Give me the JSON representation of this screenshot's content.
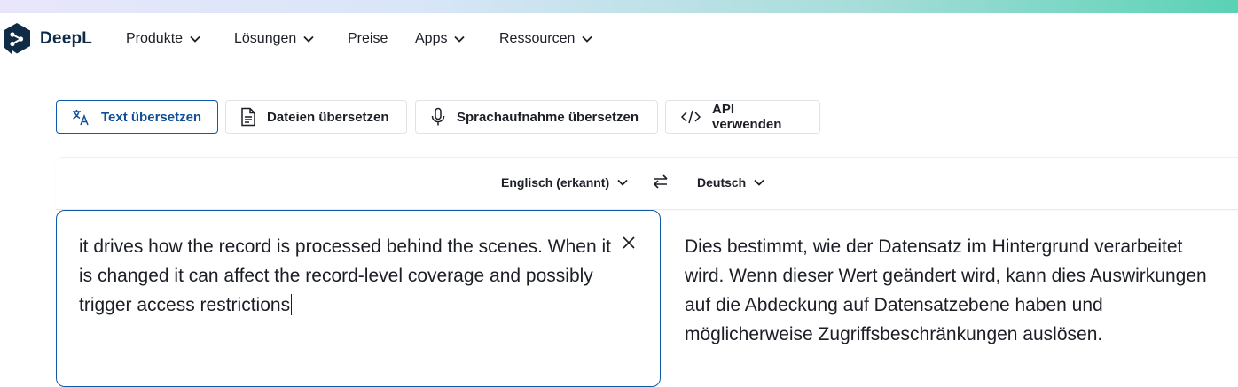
{
  "brand": {
    "name": "DeepL",
    "accent": "#0f2b46"
  },
  "nav": [
    {
      "label": "Produkte",
      "has_dropdown": true
    },
    {
      "label": "Lösungen",
      "has_dropdown": true
    },
    {
      "label": "Preise",
      "has_dropdown": false
    },
    {
      "label": "Apps",
      "has_dropdown": true
    },
    {
      "label": "Ressourcen",
      "has_dropdown": true
    }
  ],
  "tabs": [
    {
      "label": "Text übersetzen",
      "icon": "translate-icon",
      "active": true
    },
    {
      "label": "Dateien übersetzen",
      "icon": "document-icon",
      "active": false
    },
    {
      "label": "Sprachaufnahme übersetzen",
      "icon": "microphone-icon",
      "active": false
    },
    {
      "label": "API verwenden",
      "icon": "code-icon",
      "active": false
    }
  ],
  "languages": {
    "source": "Englisch (erkannt)",
    "target": "Deutsch"
  },
  "source_text": "it drives how the record is processed behind the scenes. When it is changed it can affect the record-level coverage and possibly trigger access restrictions",
  "target_text": "Dies bestimmt, wie der Datensatz im Hintergrund verarbeitet wird. Wenn dieser Wert geändert wird, kann dies Auswirkungen auf die Abdeckung auf Datensatzebene haben und möglicherweise Zugriffsbeschränkungen auslösen.",
  "colors": {
    "active_tab": "#0f5aa7",
    "text": "#1b1e25"
  }
}
